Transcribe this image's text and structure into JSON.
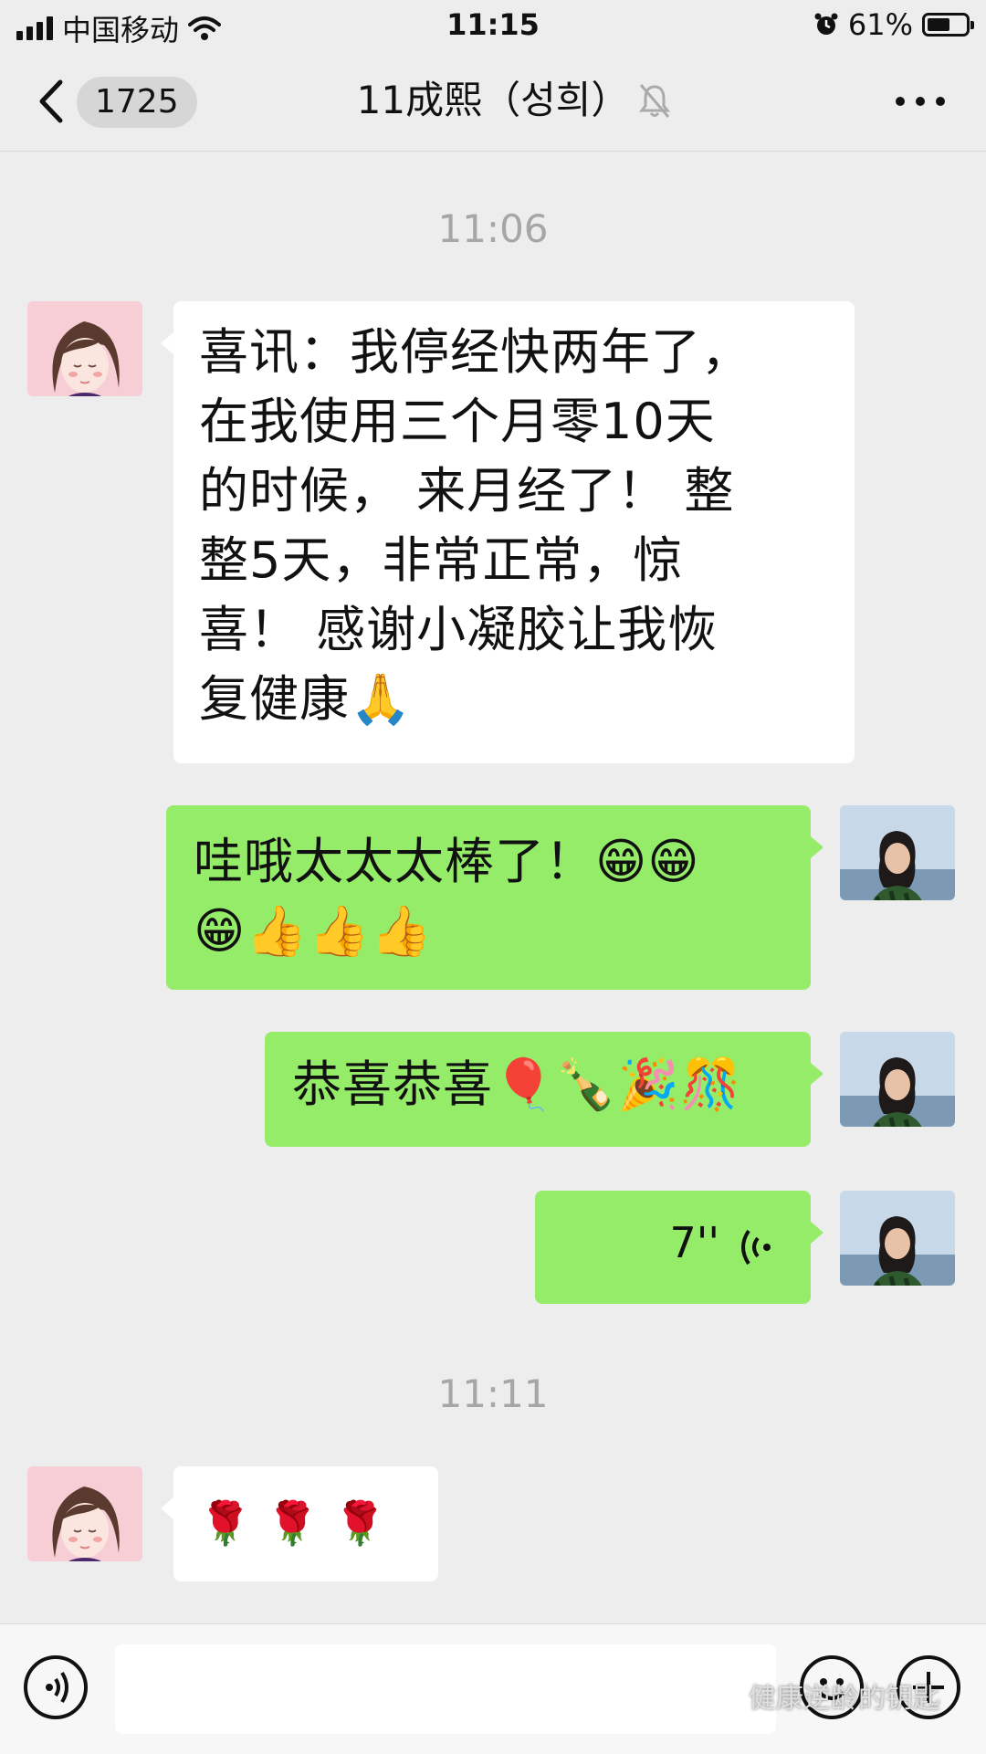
{
  "status_bar": {
    "carrier": "中国移动",
    "time": "11:15",
    "battery_percent": "61%",
    "battery_level": 0.61,
    "icons": [
      "signal-icon",
      "wifi-icon",
      "alarm-icon",
      "battery-icon"
    ]
  },
  "nav": {
    "back_icon": "chevron-left-icon",
    "unread_count": "1725",
    "title": "11成熙（성희）",
    "mute_icon": "bell-off-icon",
    "more_icon": "more-icon"
  },
  "messages": [
    {
      "type": "timestamp",
      "text": "11:06"
    },
    {
      "type": "received",
      "avatar": "cartoon-woman-avatar",
      "text": "喜讯：我停经快两年了，\n在我使用三个月零10天\n的时候， 来月经了！ 整\n整5天，非常正常，惊\n喜！ 感谢小凝胶让我恢\n复健康🙏"
    },
    {
      "type": "sent",
      "avatar": "photo-woman-avatar",
      "text": "哇哦太太太棒了！😁😁\n😁👍👍👍"
    },
    {
      "type": "sent",
      "avatar": "photo-woman-avatar",
      "text": "恭喜恭喜🎈🍾🎉🎊"
    },
    {
      "type": "sent-voice",
      "avatar": "photo-woman-avatar",
      "duration": "7''",
      "voice_icon": "voice-wave-icon"
    },
    {
      "type": "timestamp",
      "text": "11:11"
    },
    {
      "type": "received",
      "avatar": "cartoon-woman-avatar",
      "text": "🌹 🌹 🌹"
    }
  ],
  "input_bar": {
    "voice_icon": "voice-icon",
    "emoji_icon": "emoji-icon",
    "plus_icon": "plus-icon",
    "placeholder": ""
  },
  "watermark": "健康逆龄的钥匙",
  "colors": {
    "background": "#ededed",
    "sent_bubble": "#95ec69",
    "received_bubble": "#ffffff",
    "timestamp": "#a6a6a6"
  }
}
